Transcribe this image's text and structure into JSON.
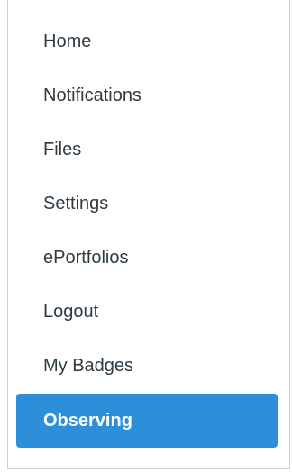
{
  "account_nav": {
    "items": [
      {
        "label": "Home",
        "active": false
      },
      {
        "label": "Notifications",
        "active": false
      },
      {
        "label": "Files",
        "active": false
      },
      {
        "label": "Settings",
        "active": false
      },
      {
        "label": "ePortfolios",
        "active": false
      },
      {
        "label": "Logout",
        "active": false
      },
      {
        "label": "My Badges",
        "active": false
      },
      {
        "label": "Observing",
        "active": true
      }
    ],
    "colors": {
      "active_background": "#2d8ed9",
      "active_text": "#ffffff",
      "text": "#2d3b45",
      "border": "#c9ced3"
    }
  }
}
